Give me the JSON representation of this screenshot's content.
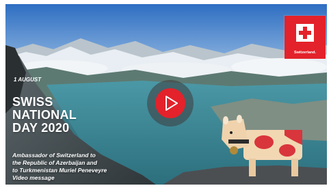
{
  "video": {
    "date_label": "1 AUGUST",
    "headline": [
      "SWISS",
      "NATIONAL",
      "DAY 2020"
    ],
    "subtitle_lines": [
      "Ambassador of Switzerland to",
      "the Republic of Azerbaijan and",
      "to Turkmenistan Muriel Peneveyre",
      "Video message"
    ]
  },
  "logo": {
    "text": "Switzerland."
  },
  "colors": {
    "brand_red": "#e3222b",
    "play_overlay": "#3c3c3c",
    "text": "#ffffff"
  },
  "icons": {
    "play": "play-triangle-icon",
    "swiss_cross": "swiss-cross-icon"
  }
}
